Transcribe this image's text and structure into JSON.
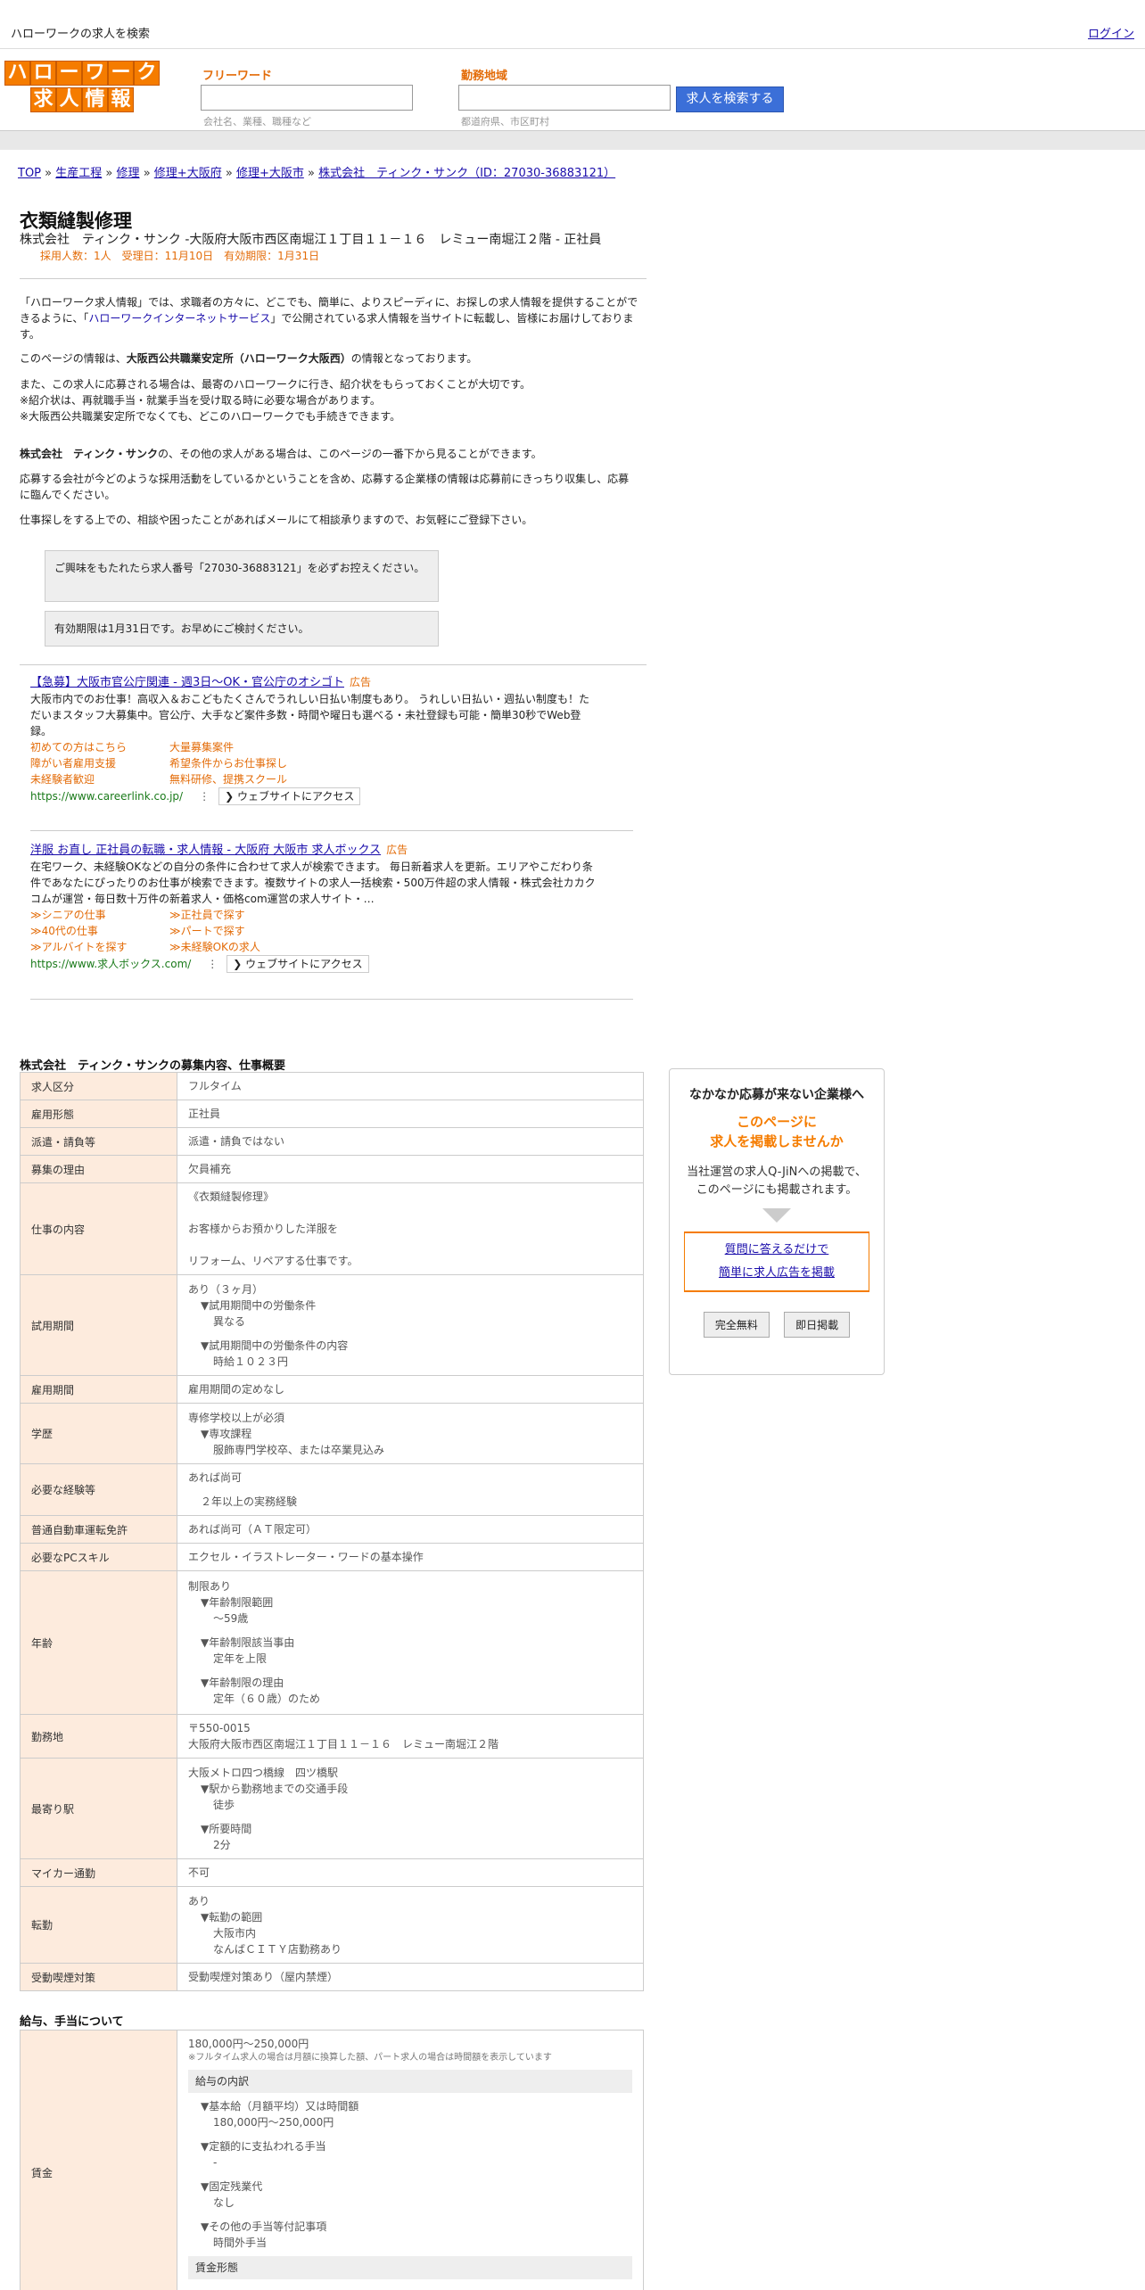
{
  "topbar": {
    "site_title": "ハローワークの求人を検索",
    "login": "ログイン"
  },
  "logo": {
    "row1": [
      "ハ",
      "ロ",
      "ー",
      "ワ",
      "ー",
      "ク"
    ],
    "row2": [
      "求",
      "人",
      "情",
      "報"
    ]
  },
  "search": {
    "freeword_label": "フリーワード",
    "freeword_hint": "会社名、業種、職種など",
    "area_label": "勤務地域",
    "area_hint": "都道府県、市区町村",
    "button": "求人を検索する"
  },
  "breadcrumb": {
    "top": "TOP",
    "cat1": "生産工程",
    "cat2": "修理",
    "cat3": "修理+大阪府",
    "cat4": "修理+大阪市",
    "company": "株式会社　ティンク・サンク（ID：27030-36883121）",
    "sep": "»"
  },
  "job": {
    "title": "衣類縫製修理",
    "company_line": "株式会社　ティンク・サンク -大阪府大阪市西区南堀江１丁目１１－１６　レミュー南堀江２階 - 正社員",
    "meta_line": "採用人数：1人　受理日：11月10日　有効期限：1月31日"
  },
  "intro": {
    "p1a": "「ハローワーク求人情報」では、求職者の方々に、どこでも、簡単に、よりスピーディに、お探しの求人情報を提供することができるように、「",
    "p1link": "ハローワークインターネットサービス",
    "p1b": "」で公開されている求人情報を当サイトに転載し、皆様にお届けしております。",
    "p2a": "このページの情報は、",
    "p2b": "大阪西公共職業安定所（ハローワーク大阪西）",
    "p2c": "の情報となっております。",
    "p3l1": "また、この求人に応募される場合は、最寄のハローワークに行き、紹介状をもらっておくことが大切です。",
    "p3l2": "※紹介状は、再就職手当・就業手当を受け取る時に必要な場合があります。",
    "p3l3": "※大阪西公共職業安定所でなくても、どこのハローワークでも手続きできます。",
    "p4a": "株式会社　ティンク・サンク",
    "p4b": "の、その他の求人がある場合は、このページの一番下から見ることができます。",
    "p5": "応募する会社が今どのような採用活動をしているかということを含め、応募する企業様の情報は応募前にきっちり収集し、応募に臨んでください。",
    "p6": "仕事探しをする上での、相談や困ったことがあればメールにて相談承りますので、お気軽にご登録下さい。",
    "notice1": "ご興味をもたれたら求人番号「27030-36883121」を必ずお控えください。",
    "notice2": "有効期限は1月31日です。お早めにご検討ください。"
  },
  "ads": [
    {
      "title": "【急募】大阪市官公庁関連 - 週3日～OK・官公庁のオシゴト",
      "badge": "広告",
      "desc": "大阪市内でのお仕事！高収入＆おこどもたくさんでうれしい日払い制度もあり。 うれしい日払い・週払い制度も！ただいまスタッフ大募集中。官公庁、大手など案件多数・時間や曜日も選べる・未社登録も可能・簡単30秒でWeb登録。",
      "links": [
        "初めての方はこちら",
        "大量募集案件",
        "障がい者雇用支援",
        "希望条件からお仕事探し",
        "未経験者歓迎",
        "無料研修、提携スクール"
      ],
      "url": "https://www.careerlink.co.jp/",
      "visit": "❯ ウェブサイトにアクセス"
    },
    {
      "title": "洋服 お直し 正社員の転職・求人情報 - 大阪府 大阪市 求人ボックス",
      "badge": "広告",
      "desc": "在宅ワーク、未経験OKなどの自分の条件に合わせて求人が検索できます。 毎日新着求人を更新。エリアやこだわり条件であなたにぴったりのお仕事が検索できます。複数サイトの求人一括検索・500万件超の求人情報・株式会社カカクコムが運営・毎日数十万件の新着求人・価格com運営の求人サイト・…",
      "links": [
        "≫シニアの仕事",
        "≫正社員で探す",
        "≫40代の仕事",
        "≫パートで探す",
        "≫アルバイトを探す",
        "≫未経験OKの求人"
      ],
      "url": "https://www.求人ボックス.com/",
      "visit": "❯ ウェブサイトにアクセス"
    }
  ],
  "details": {
    "section_title": "株式会社　ティンク・サンクの募集内容、仕事概要",
    "rows": {
      "r1": {
        "label": "求人区分",
        "value": "フルタイム"
      },
      "r2": {
        "label": "雇用形態",
        "value": "正社員"
      },
      "r3": {
        "label": "派遣・請負等",
        "value": "派遣・請負ではない"
      },
      "r4": {
        "label": "募集の理由",
        "value": "欠員補充"
      },
      "r5": {
        "label": "仕事の内容",
        "v1": "《衣類縫製修理》",
        "v2": "お客様からお預かりした洋服を",
        "v3": "リフォーム、リペアする仕事です。"
      },
      "r6": {
        "label": "試用期間",
        "v1": "あり（３ヶ月）",
        "v2": "▼試用期間中の労働条件",
        "v3": "異なる",
        "v4": "▼試用期間中の労働条件の内容",
        "v5": "時給１０２３円"
      },
      "r7": {
        "label": "雇用期間",
        "value": "雇用期間の定めなし"
      },
      "r8": {
        "label": "学歴",
        "v1": "専修学校以上が必須",
        "v2": "▼専攻課程",
        "v3": "服飾専門学校卒、または卒業見込み"
      },
      "r9": {
        "label": "必要な経験等",
        "v1": "あれば尚可",
        "v2": "２年以上の実務経験"
      },
      "r10": {
        "label": "普通自動車運転免許",
        "value": "あれば尚可（ＡＴ限定可）"
      },
      "r11": {
        "label": "必要なPCスキル",
        "value": "エクセル・イラストレーター・ワードの基本操作"
      },
      "r12": {
        "label": "年齢",
        "v1": "制限あり",
        "v2": "▼年齢制限範囲",
        "v3": "〜59歳",
        "v4": "▼年齢制限該当事由",
        "v5": "定年を上限",
        "v6": "▼年齢制限の理由",
        "v7": "定年（６０歳）のため"
      },
      "r13": {
        "label": "勤務地",
        "v1": "〒550-0015",
        "v2": "大阪府大阪市西区南堀江１丁目１１－１６　レミュー南堀江２階"
      },
      "r14": {
        "label": "最寄り駅",
        "v1": "大阪メトロ四つ橋線　四ツ橋駅",
        "v2": "▼駅から勤務地までの交通手段",
        "v3": "徒歩",
        "v4": "▼所要時間",
        "v5": "2分"
      },
      "r15": {
        "label": "マイカー通勤",
        "value": "不可"
      },
      "r16": {
        "label": "転勤",
        "v1": "あり",
        "v2": "▼転勤の範囲",
        "v3": "大阪市内",
        "v4": "なんばＣＩＴＹ店勤務あり"
      },
      "r17": {
        "label": "受動喫煙対策",
        "value": "受動喫煙対策あり（屋内禁煙）"
      }
    }
  },
  "wage": {
    "section_title": "給与、手当について",
    "label": "賃金",
    "range": "180,000円〜250,000円",
    "note": "※フルタイム求人の場合は月額に換算した額、パート求人の場合は時間額を表示しています",
    "breakdown_title": "給与の内訳",
    "b1": "▼基本給（月額平均）又は時間額",
    "b1v": "180,000円〜250,000円",
    "b2": "▼定額的に支払われる手当",
    "b2v": "-",
    "b3": "▼固定残業代",
    "b3v": "なし",
    "b4": "▼その他の手当等付記事項",
    "b4v": "時間外手当",
    "form_title": "賃金形態"
  },
  "sidebar": {
    "title": "なかなか応募が来ない企業様へ",
    "orange1": "このページに",
    "orange2": "求人を掲載しませんか",
    "text1": "当社運営の求人Q-JiNへの掲載で、",
    "text2": "このページにも掲載されます。",
    "link1": "質問に答えるだけで",
    "link2": "簡単に求人広告を掲載",
    "btn1": "完全無料",
    "btn2": "即日掲載"
  }
}
